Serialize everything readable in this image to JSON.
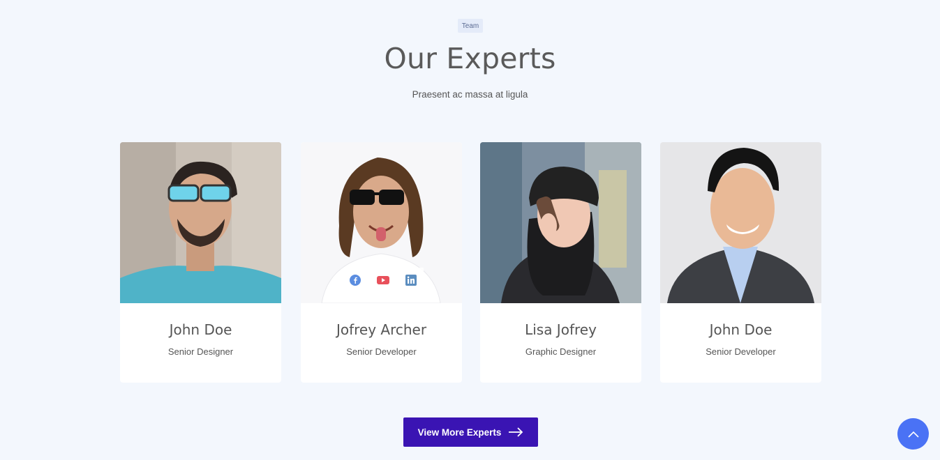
{
  "section": {
    "tag": "Team",
    "title": "Our Experts",
    "subtitle": "Praesent ac massa at ligula"
  },
  "team": [
    {
      "name": "John Doe",
      "role": "Senior Designer"
    },
    {
      "name": "Jofrey Archer",
      "role": "Senior Developer"
    },
    {
      "name": "Lisa Jofrey",
      "role": "Graphic Designer"
    },
    {
      "name": "John Doe",
      "role": "Senior Developer"
    }
  ],
  "socials": [
    "facebook-icon",
    "youtube-icon",
    "linkedin-icon"
  ],
  "cta": {
    "label": "View More Experts"
  },
  "colors": {
    "background": "#f3f7fd",
    "button": "#3a14b3",
    "scroll_button": "#4a72f5"
  }
}
